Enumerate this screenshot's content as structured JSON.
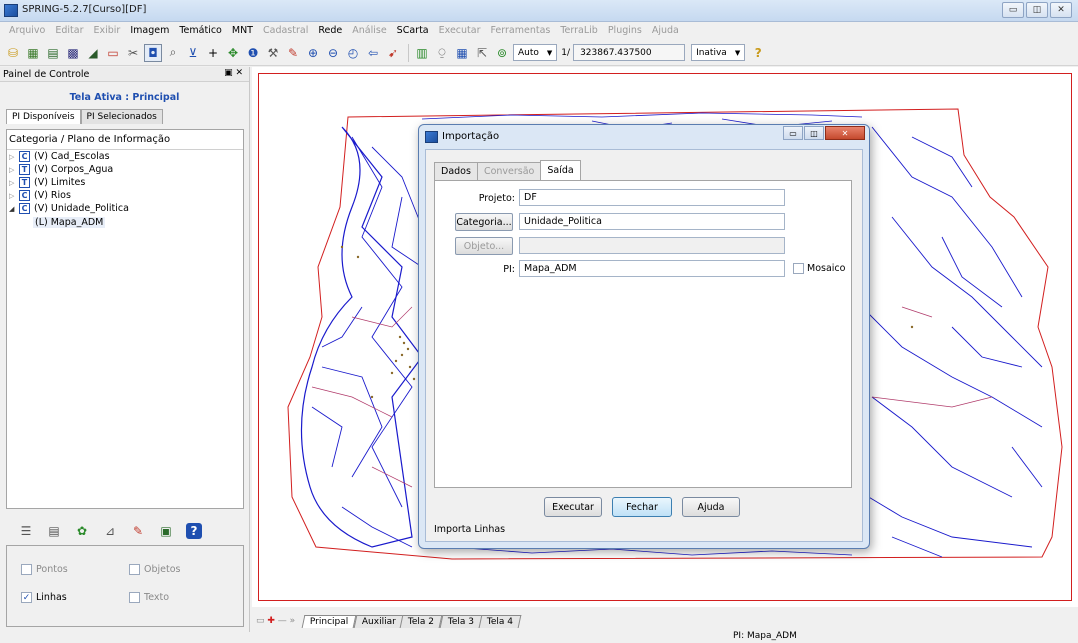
{
  "app": {
    "title": "SPRING-5.2.7[Curso][DF]"
  },
  "window_controls": {
    "minimize": "▭",
    "maximize": "◫",
    "close": "✕"
  },
  "menu": [
    {
      "label": "Arquivo",
      "enabled": false
    },
    {
      "label": "Editar",
      "enabled": false
    },
    {
      "label": "Exibir",
      "enabled": false
    },
    {
      "label": "Imagem",
      "enabled": true
    },
    {
      "label": "Temático",
      "enabled": true
    },
    {
      "label": "MNT",
      "enabled": true
    },
    {
      "label": "Cadastral",
      "enabled": false
    },
    {
      "label": "Rede",
      "enabled": true
    },
    {
      "label": "Análise",
      "enabled": false
    },
    {
      "label": "SCarta",
      "enabled": true
    },
    {
      "label": "Executar",
      "enabled": false
    },
    {
      "label": "Ferramentas",
      "enabled": false
    },
    {
      "label": "TerraLib",
      "enabled": false
    },
    {
      "label": "Plugins",
      "enabled": false
    },
    {
      "label": "Ajuda",
      "enabled": false
    }
  ],
  "toolbar": {
    "zoom_mode": "Auto",
    "scale_prefix": "1/",
    "scale_value": "323867.437500",
    "cursor_mode": "Inativa",
    "icons": [
      "database-icon",
      "model-icon",
      "project-icon",
      "grid-icon",
      "draw-icon",
      "window-icon",
      "scissors-icon",
      "zoom-box-icon",
      "zoom-icon",
      "plan-icon",
      "plus-icon",
      "pan-icon",
      "info-icon",
      "tool-icon",
      "edit-icon",
      "zoom-in-icon",
      "zoom-out-icon",
      "zoom-prev-icon",
      "back-icon",
      "cursor-icon",
      "display-icon",
      "zoom-area-icon",
      "table-icon",
      "coord-icon",
      "link-icon"
    ],
    "help_icon": "?"
  },
  "panel": {
    "title": "Painel de Controle",
    "controls": "▣ ✕",
    "active_screen": "Tela Ativa : Principal",
    "tabs": [
      "PI Disponíveis",
      "PI Selecionados"
    ],
    "tree_header": "Categoria / Plano de Informação",
    "tree": [
      {
        "badge": "C",
        "label": "(V) Cad_Escolas",
        "expanded": false
      },
      {
        "badge": "T",
        "label": "(V) Corpos_Agua",
        "expanded": false
      },
      {
        "badge": "T",
        "label": "(V) Limites",
        "expanded": false
      },
      {
        "badge": "C",
        "label": "(V) Rios",
        "expanded": false
      },
      {
        "badge": "C",
        "label": "(V) Unidade_Politica",
        "expanded": true
      }
    ],
    "tree_child": "(L) Mapa_ADM",
    "visibility": {
      "pontos": "Pontos",
      "objetos": "Objetos",
      "linhas": "Linhas",
      "texto": "Texto",
      "linhas_checked": true
    }
  },
  "dialog": {
    "title": "Importação",
    "tabs": [
      "Dados",
      "Conversão",
      "Saída"
    ],
    "fields": {
      "projeto_label": "Projeto:",
      "projeto_value": "DF",
      "categoria_button": "Categoria...",
      "categoria_value": "Unidade_Politica",
      "objeto_button": "Objeto...",
      "objeto_value": "",
      "pi_label": "PI:",
      "pi_value": "Mapa_ADM",
      "mosaico_label": "Mosaico"
    },
    "buttons": {
      "executar": "Executar",
      "fechar": "Fechar",
      "ajuda": "Ajuda"
    },
    "status": "Importa Linhas"
  },
  "bottom_tabs": [
    "Principal",
    "Auxiliar",
    "Tela 2",
    "Tela 3",
    "Tela 4"
  ],
  "status_bar": {
    "pi": "PI: Mapa_ADM"
  },
  "colors": {
    "rivers": "#1a1acc",
    "frame": "#d21f1f",
    "accent": "#1f4fb0"
  }
}
